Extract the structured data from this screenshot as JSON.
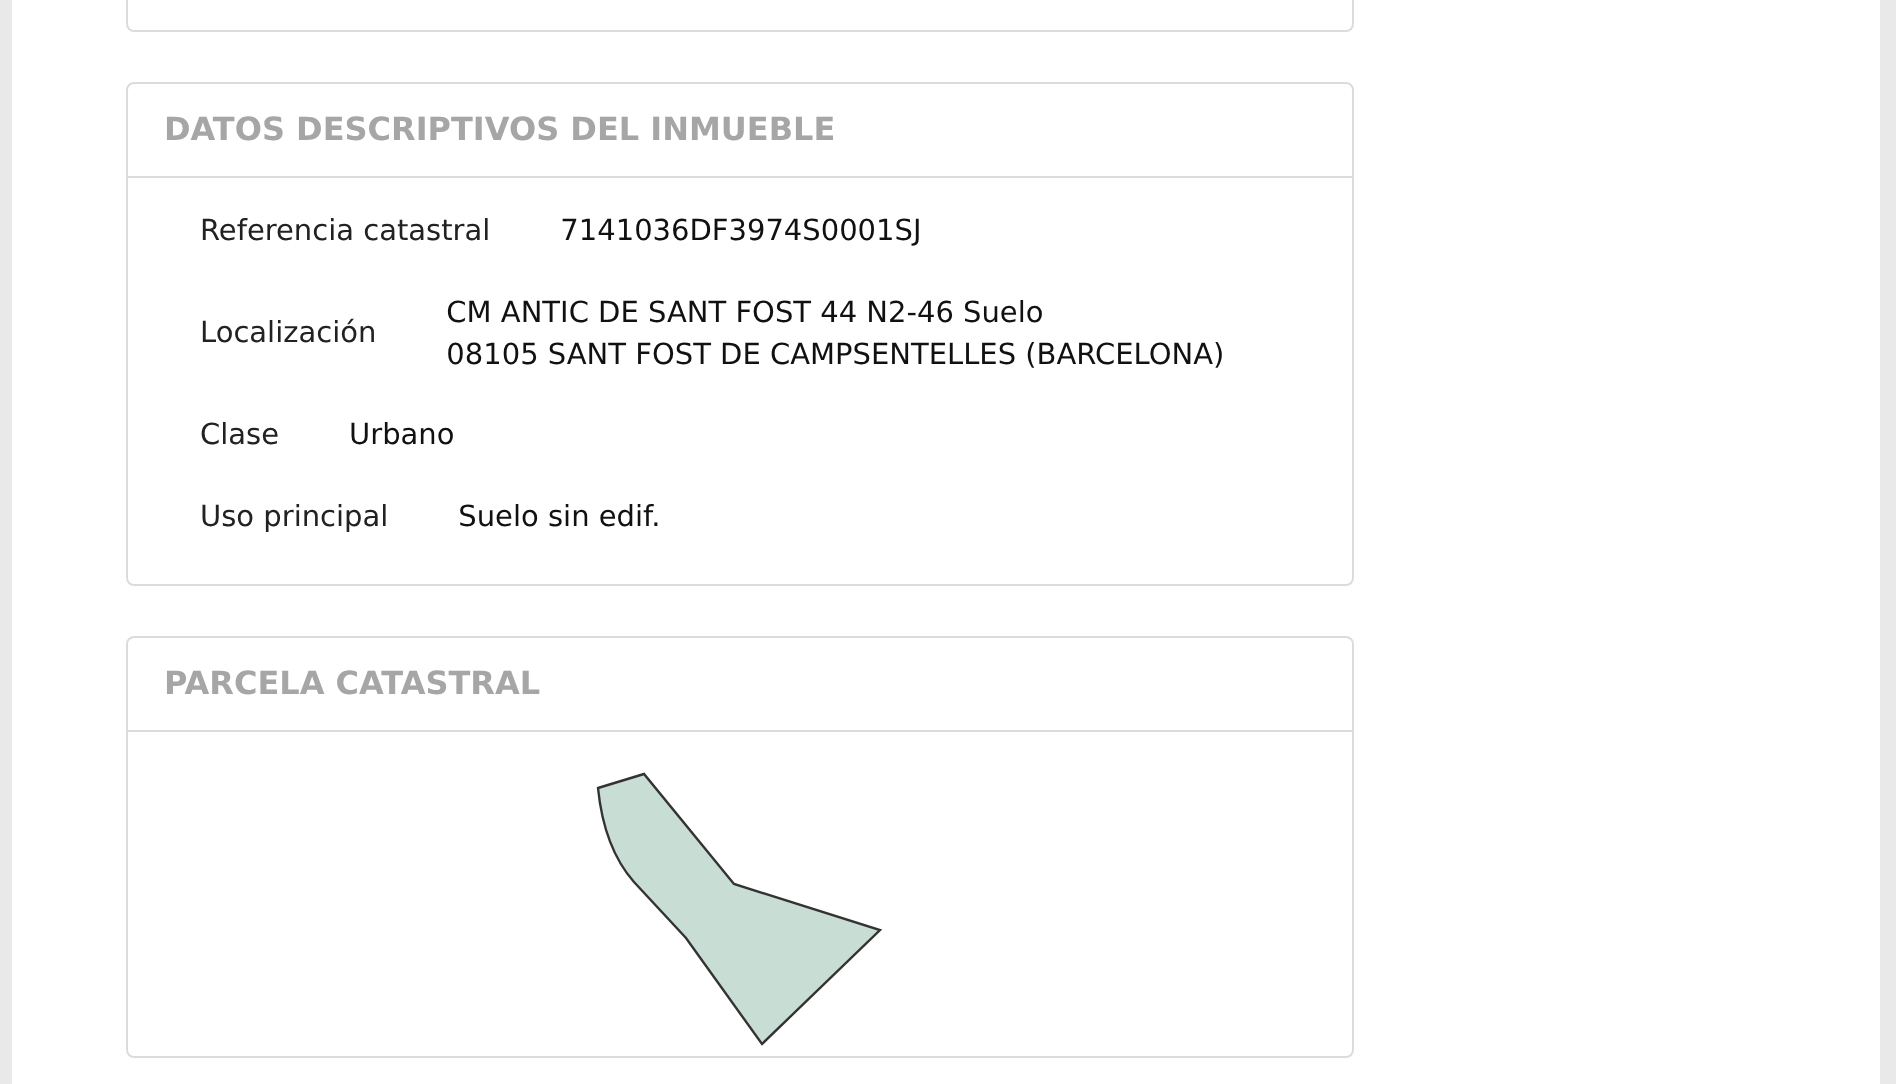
{
  "sections": [
    {
      "title": "DATOS DESCRIPTIVOS DEL INMUEBLE",
      "kind": "fields",
      "fields": [
        {
          "label": "Referencia catastral",
          "lines": [
            "7141036DF3974S0001SJ"
          ]
        },
        {
          "label": "Localización",
          "lines": [
            "CM ANTIC DE SANT FOST 44 N2-46 Suelo",
            "08105 SANT FOST DE CAMPSENTELLES (BARCELONA)"
          ]
        },
        {
          "label": "Clase",
          "lines": [
            "Urbano"
          ]
        },
        {
          "label": "Uso principal",
          "lines": [
            "Suelo sin edif."
          ]
        }
      ]
    },
    {
      "title": "PARCELA CATASTRAL",
      "kind": "parcel"
    }
  ]
}
